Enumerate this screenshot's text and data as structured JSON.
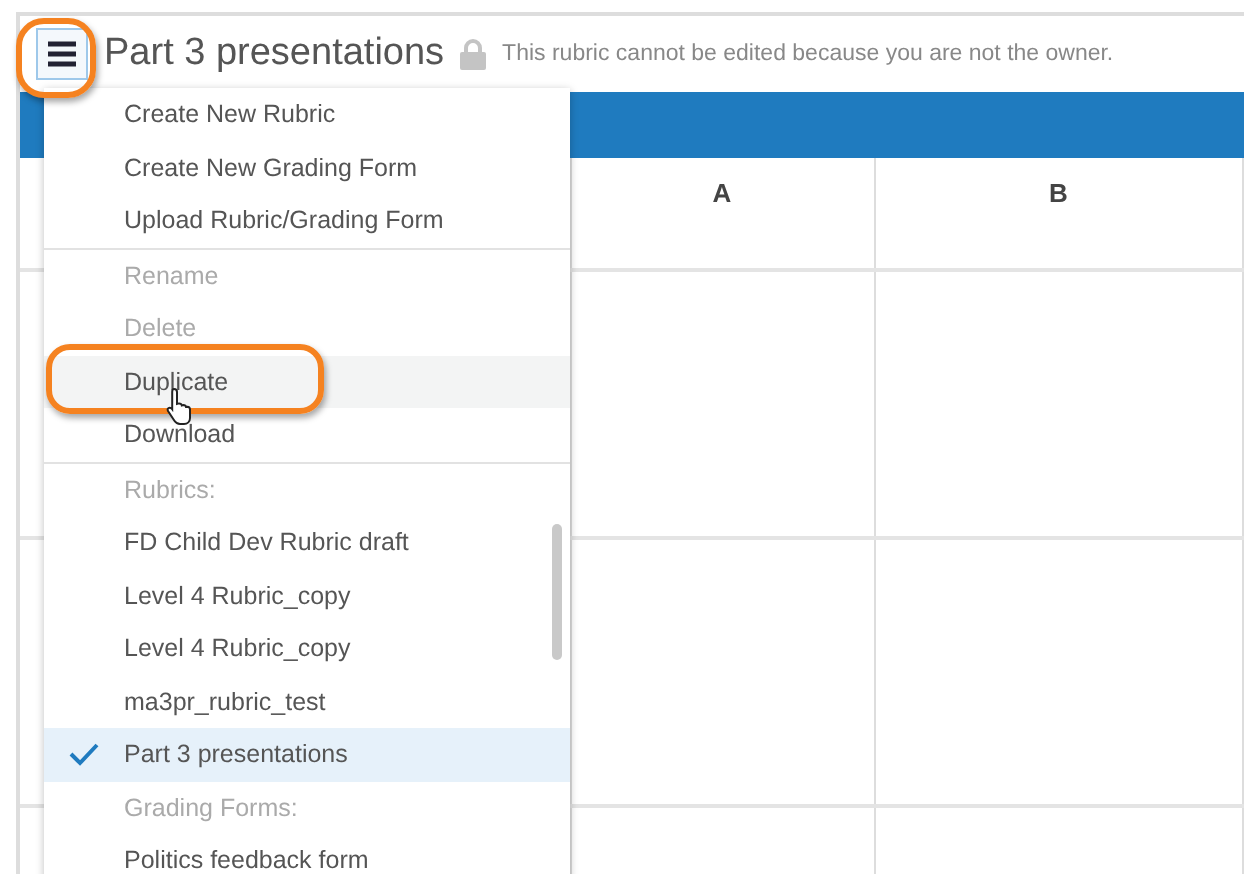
{
  "header": {
    "title": "Part 3 presentations",
    "notice": "This rubric cannot be edited because you are not the owner."
  },
  "table": {
    "columns": [
      "A",
      "B"
    ]
  },
  "menu": {
    "sections": [
      {
        "items": [
          {
            "kind": "action",
            "label": "Create New Rubric",
            "disabled": false,
            "hovered": false
          },
          {
            "kind": "action",
            "label": "Create New Grading Form",
            "disabled": false,
            "hovered": false
          },
          {
            "kind": "action",
            "label": "Upload Rubric/Grading Form",
            "disabled": false,
            "hovered": false
          }
        ]
      },
      {
        "items": [
          {
            "kind": "action",
            "label": "Rename",
            "disabled": true,
            "hovered": false
          },
          {
            "kind": "action",
            "label": "Delete",
            "disabled": true,
            "hovered": false
          },
          {
            "kind": "action",
            "label": "Duplicate",
            "disabled": false,
            "hovered": true
          },
          {
            "kind": "action",
            "label": "Download",
            "disabled": false,
            "hovered": false
          }
        ]
      },
      {
        "items": [
          {
            "kind": "header",
            "label": "Rubrics:"
          },
          {
            "kind": "choice",
            "label": "FD Child Dev Rubric draft",
            "selected": false
          },
          {
            "kind": "choice",
            "label": "Level 4 Rubric_copy",
            "selected": false
          },
          {
            "kind": "choice",
            "label": "Level 4 Rubric_copy",
            "selected": false
          },
          {
            "kind": "choice",
            "label": "ma3pr_rubric_test",
            "selected": false
          },
          {
            "kind": "choice",
            "label": "Part 3 presentations",
            "selected": true
          },
          {
            "kind": "header",
            "label": "Grading Forms:"
          },
          {
            "kind": "choice",
            "label": "Politics feedback form",
            "selected": false
          }
        ]
      }
    ]
  }
}
